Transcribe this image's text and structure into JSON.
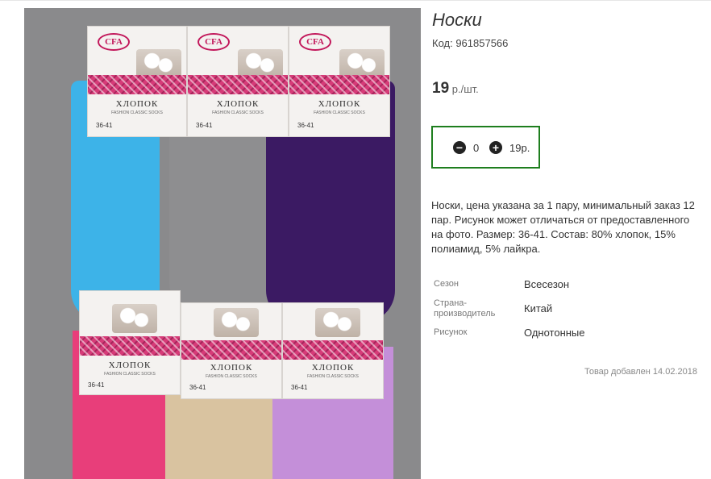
{
  "product": {
    "title": "Носки",
    "code": "Код: 961857566",
    "price_amount": "19",
    "price_unit": " р./шт.",
    "quantity": "0",
    "sum": "19р.",
    "description": "Носки, цена указана за 1 пару, минимальный заказ 12 пар. Рисунок может отличаться от предоставленного на фото. Размер: 36-41. Состав: 80% хлопок, 15% полиамид, 5% лайкра.",
    "properties": [
      {
        "label": "Сезон",
        "value": "Всесезон"
      },
      {
        "label": "Страна-производитель",
        "value": "Китай"
      },
      {
        "label": "Рисунок",
        "value": "Однотонные"
      }
    ],
    "added": "Товар добавлен 14.02.2018"
  },
  "controls": {
    "minus_icon": "minus-circle-icon",
    "plus_icon": "plus-circle-icon",
    "accent": "#1e7e1e"
  },
  "photo": {
    "brand": "CFA",
    "material": "ХЛОПОК",
    "subtitle": "FASHION CLASSIC SOCKS",
    "size": "36-41",
    "sock_colors": [
      "#3db3e8",
      "#8e8e90",
      "#3b1a63",
      "#e83e7a",
      "#d9c3a0",
      "#c48fd9"
    ]
  }
}
